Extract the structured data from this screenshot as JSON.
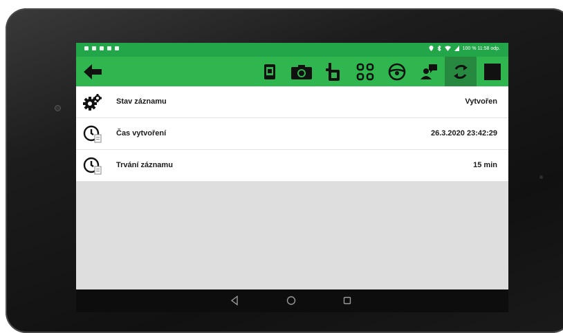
{
  "colors": {
    "accent": "#2fb64e",
    "status_bar": "#23a64a",
    "active_tool": "#27883f",
    "list_background": "#dedede",
    "nav_bar": "#0d0d0d"
  },
  "status_bar": {
    "right_text": "100 % 11:58 odp."
  },
  "toolbar": {
    "back_icon": "arrow-left-icon",
    "tools": [
      {
        "icon": "document-icon"
      },
      {
        "icon": "camera-icon"
      },
      {
        "icon": "crop-icon"
      },
      {
        "icon": "grid-icon"
      },
      {
        "icon": "steering-wheel-icon"
      },
      {
        "icon": "user-message-icon"
      },
      {
        "icon": "refresh-icon",
        "active": true
      },
      {
        "icon": "stop-icon"
      }
    ]
  },
  "records": [
    {
      "icon": "gears-icon",
      "label": "Stav záznamu",
      "value": "Vytvořen"
    },
    {
      "icon": "clock-file-icon",
      "label": "Čas vytvoření",
      "value": "26.3.2020 23:42:29"
    },
    {
      "icon": "clock-file-icon",
      "label": "Trvání záznamu",
      "value": "15 min"
    }
  ],
  "nav_bar": {
    "back": "nav-back-icon",
    "home": "nav-home-icon",
    "recents": "nav-recents-icon"
  }
}
